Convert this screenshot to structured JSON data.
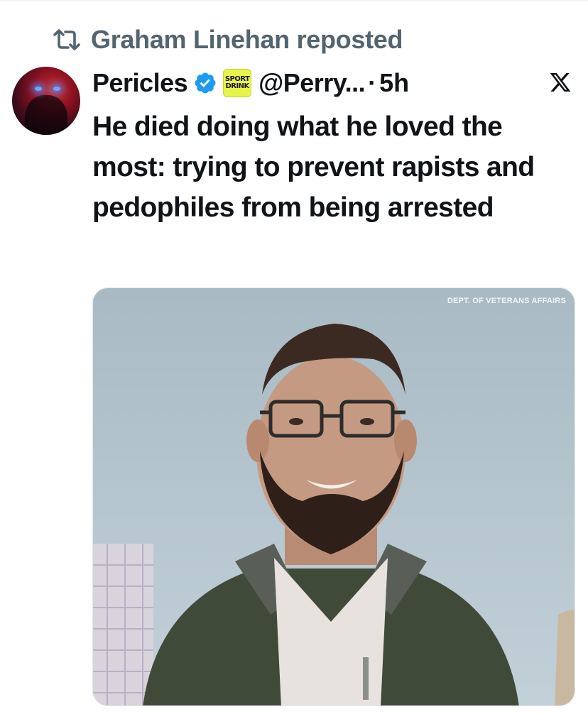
{
  "repost": {
    "text": "Graham Linehan reposted",
    "icon": "repost-icon"
  },
  "post": {
    "display_name": "Pericles",
    "verified_icon": "verified-badge-icon",
    "affiliate_badge": {
      "line1": "SPORT",
      "line2": "DRINK"
    },
    "handle": "@Perry...",
    "separator": "·",
    "time": "5h",
    "platform_icon": "x-logo-icon",
    "text": "He died doing what he loved the most: trying to prevent rapists and pedophiles from being arrested"
  },
  "media": {
    "watermark": "DEPT. OF VETERANS AFFAIRS"
  },
  "colors": {
    "text_primary": "#0f1419",
    "text_secondary": "#536471",
    "verified_blue": "#1d9bf0",
    "badge_yellow": "#e8f44a"
  }
}
